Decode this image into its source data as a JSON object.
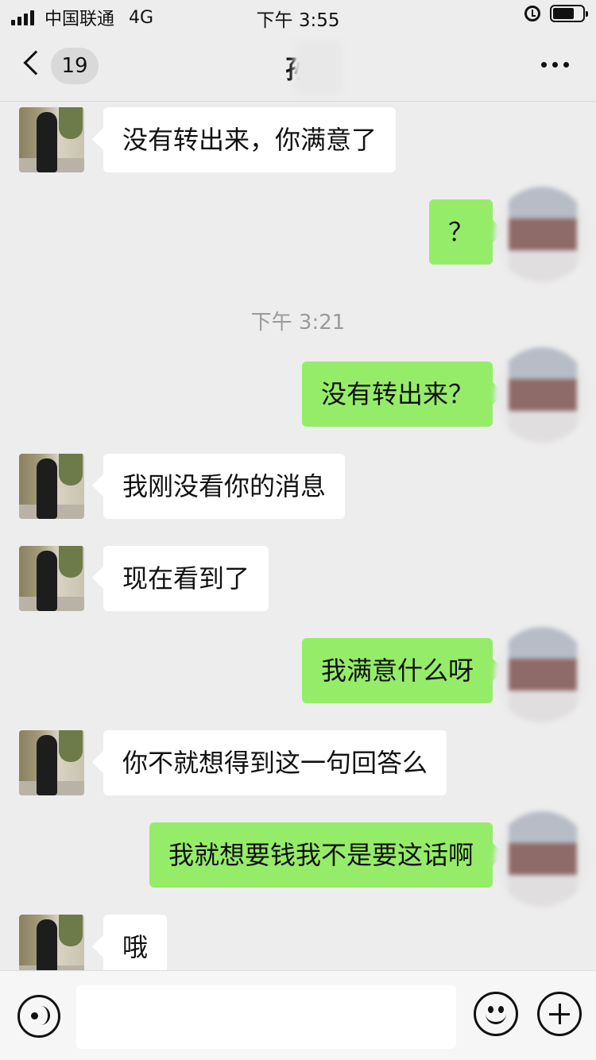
{
  "status_bar": {
    "carrier": "中国联通",
    "network": "4G",
    "time": "下午 3:55",
    "icons": [
      "signal-icon",
      "alarm-icon",
      "battery-icon"
    ]
  },
  "nav": {
    "unread_count": "19",
    "title": "孙",
    "icons": [
      "back-icon",
      "more-icon"
    ]
  },
  "messages": [
    {
      "side": "left",
      "text": "没有转出来，你满意了"
    },
    {
      "side": "right",
      "text": "？"
    },
    {
      "type": "timestamp",
      "text": "下午 3:21"
    },
    {
      "side": "right",
      "text": "没有转出来？"
    },
    {
      "side": "left",
      "text": "我刚没看你的消息"
    },
    {
      "side": "left",
      "text": "现在看到了"
    },
    {
      "side": "right",
      "text": "我满意什么呀"
    },
    {
      "side": "left",
      "text": "你不就想得到这一句回答么"
    },
    {
      "side": "right",
      "text": "我就想要钱我不是要这话啊"
    },
    {
      "side": "left",
      "text": "哦"
    }
  ],
  "input_bar": {
    "value": "",
    "icons": [
      "voice-icon",
      "emoji-icon",
      "plus-icon"
    ]
  },
  "colors": {
    "background": "#ededed",
    "sent_bubble": "#95ec69",
    "received_bubble": "#ffffff"
  }
}
